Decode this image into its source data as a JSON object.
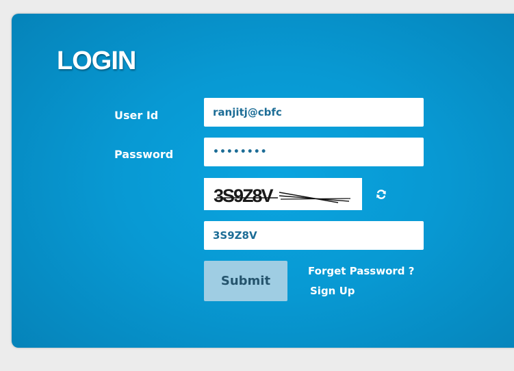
{
  "login": {
    "title": "LOGIN",
    "user_id_label": "User Id",
    "user_id_value": "ranjitj@cbfc",
    "password_label": "Password",
    "password_value": "••••••••",
    "captcha_text": "3S9Z8V",
    "captcha_input_value": "3S9Z8V",
    "submit_label": "Submit",
    "forget_password_label": "Forget Password ?",
    "sign_up_label": "Sign Up"
  },
  "icons": {
    "refresh": "refresh-icon"
  },
  "colors": {
    "panel": "#0899d3",
    "button": "#9fcde3",
    "input_text": "#1d6d96",
    "background": "#ececec"
  }
}
